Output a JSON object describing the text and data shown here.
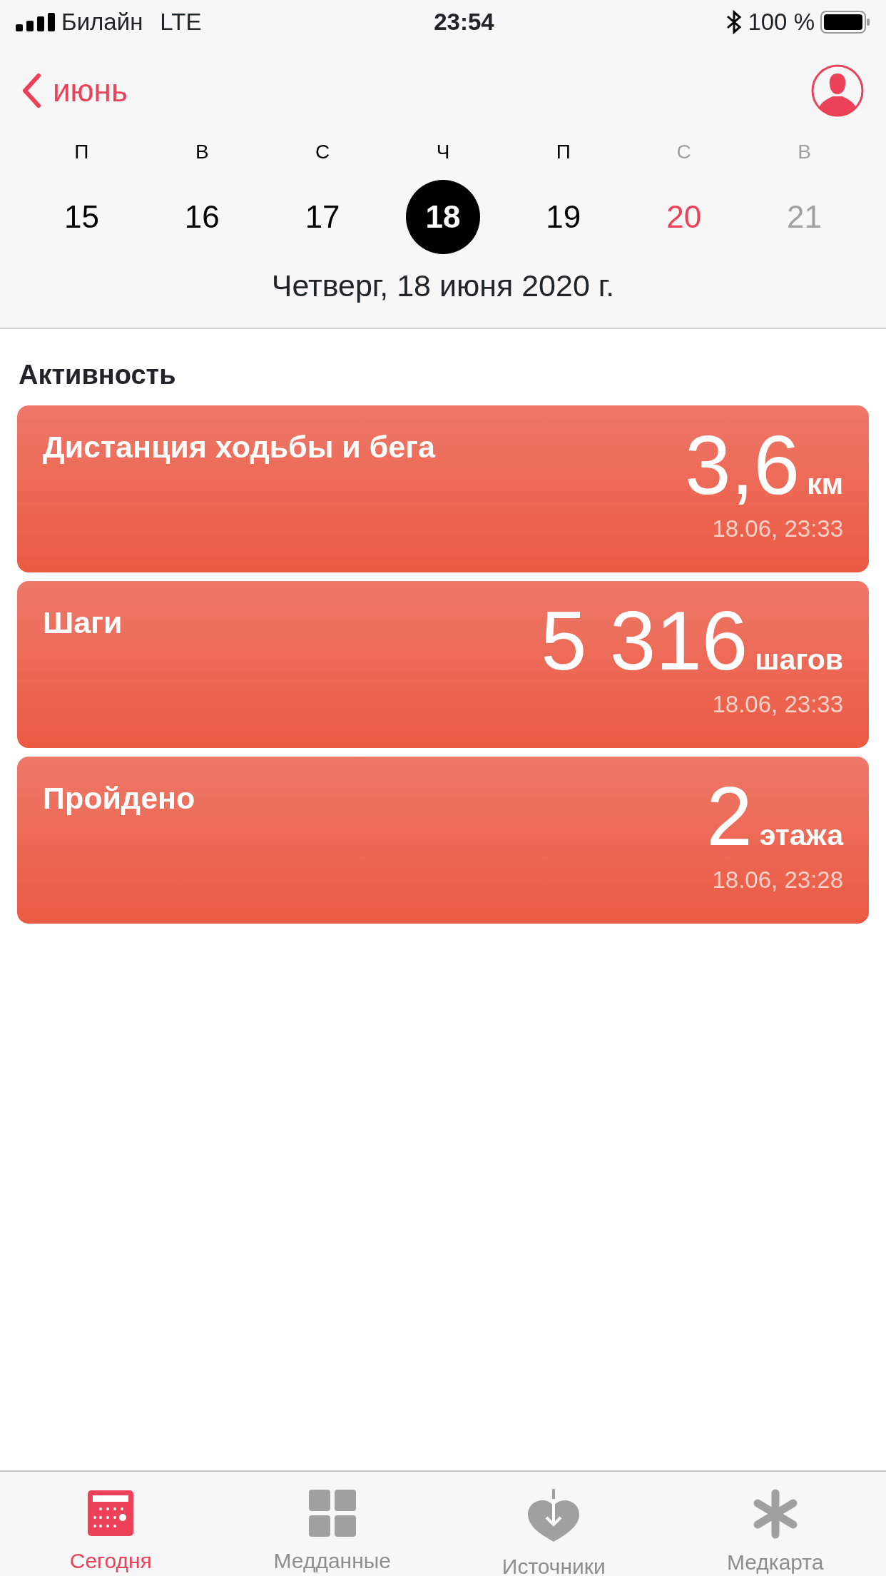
{
  "status_bar": {
    "carrier": "Билайн",
    "network": "LTE",
    "time": "23:54",
    "battery": "100 %"
  },
  "header": {
    "back_label": "июнь"
  },
  "week": [
    {
      "letter": "П",
      "number": "15",
      "selected": false,
      "kind": "normal"
    },
    {
      "letter": "В",
      "number": "16",
      "selected": false,
      "kind": "normal"
    },
    {
      "letter": "С",
      "number": "17",
      "selected": false,
      "kind": "normal"
    },
    {
      "letter": "Ч",
      "number": "18",
      "selected": true,
      "kind": "normal"
    },
    {
      "letter": "П",
      "number": "19",
      "selected": false,
      "kind": "normal"
    },
    {
      "letter": "С",
      "number": "20",
      "selected": false,
      "kind": "accent"
    },
    {
      "letter": "В",
      "number": "21",
      "selected": false,
      "kind": "muted"
    }
  ],
  "full_date": "Четверг, 18 июня 2020 г.",
  "section_title": "Активность",
  "cards": [
    {
      "title": "Дистанция ходьбы и бега",
      "value": "3,6",
      "unit": "км",
      "timestamp": "18.06, 23:33"
    },
    {
      "title": "Шаги",
      "value": "5 316",
      "unit": "шагов",
      "timestamp": "18.06, 23:33"
    },
    {
      "title": "Пройдено",
      "value": "2",
      "unit": "этажа",
      "timestamp": "18.06, 23:28"
    }
  ],
  "tabs": [
    {
      "label": "Сегодня",
      "selected": true,
      "kind": "today"
    },
    {
      "label": "Медданные",
      "selected": false,
      "kind": "data"
    },
    {
      "label": "Источники",
      "selected": false,
      "kind": "sources"
    },
    {
      "label": "Медкарта",
      "selected": false,
      "kind": "medical"
    }
  ]
}
